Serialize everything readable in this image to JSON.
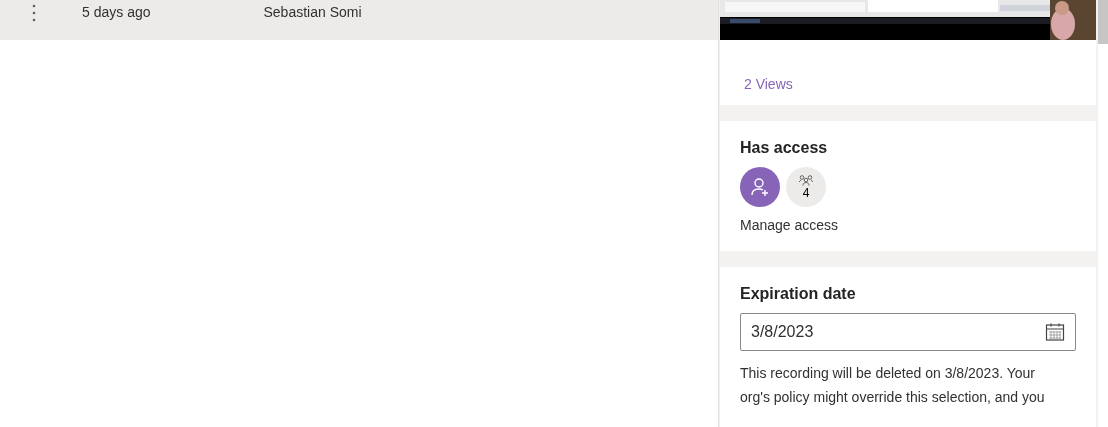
{
  "list_row": {
    "modified": "5 days ago",
    "owner": "Sebastian Somi"
  },
  "details": {
    "views": "2 Views",
    "access": {
      "title": "Has access",
      "member_count": "4",
      "manage_label": "Manage access"
    },
    "expiration": {
      "title": "Expiration date",
      "value": "3/8/2023",
      "description": "This recording will be deleted on 3/8/2023. Your org's policy might override this selection, and you"
    }
  }
}
